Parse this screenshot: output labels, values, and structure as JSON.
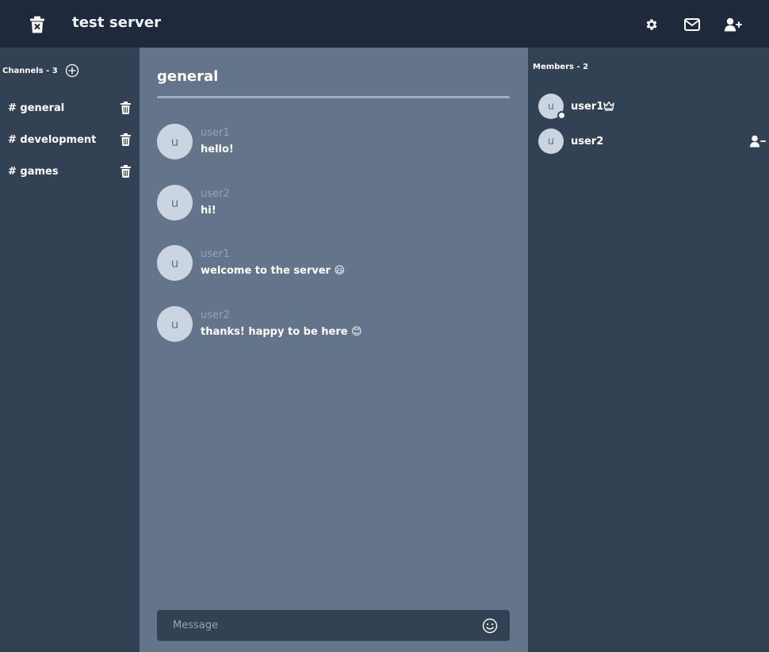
{
  "header": {
    "server_name": "test server",
    "icons": [
      "delete-server-icon",
      "gear-icon",
      "mail-icon",
      "add-user-icon"
    ]
  },
  "sidebar": {
    "channels_title": "Channels - 3",
    "add_icon": "plus-circle-icon",
    "channels": [
      {
        "label": "# general",
        "delete_icon": "trash-icon"
      },
      {
        "label": "# development",
        "delete_icon": "trash-icon"
      },
      {
        "label": "# games",
        "delete_icon": "trash-icon"
      }
    ]
  },
  "main": {
    "channel_title": "general",
    "messages": [
      {
        "avatar": "u",
        "author": "user1",
        "text": "hello!"
      },
      {
        "avatar": "u",
        "author": "user2",
        "text": "hi!"
      },
      {
        "avatar": "u",
        "author": "user1",
        "text": "welcome to the server 😃"
      },
      {
        "avatar": "u",
        "author": "user2",
        "text": "thanks! happy to be here 😊"
      }
    ],
    "composer": {
      "placeholder": "Message",
      "value": "",
      "emoji_icon": "smiley-icon"
    }
  },
  "members": {
    "title": "Members - 2",
    "list": [
      {
        "avatar": "u",
        "name": "user1",
        "online": true,
        "owner_icon": "crown-icon"
      },
      {
        "avatar": "u",
        "name": "user2",
        "online": false,
        "action_icon": "remove-user-icon"
      }
    ]
  },
  "colors": {
    "topbar": "#1e293b",
    "panel": "#334155",
    "chat": "#64748b",
    "avatar": "#cbd5e1",
    "muted_text": "#94a3b8"
  }
}
